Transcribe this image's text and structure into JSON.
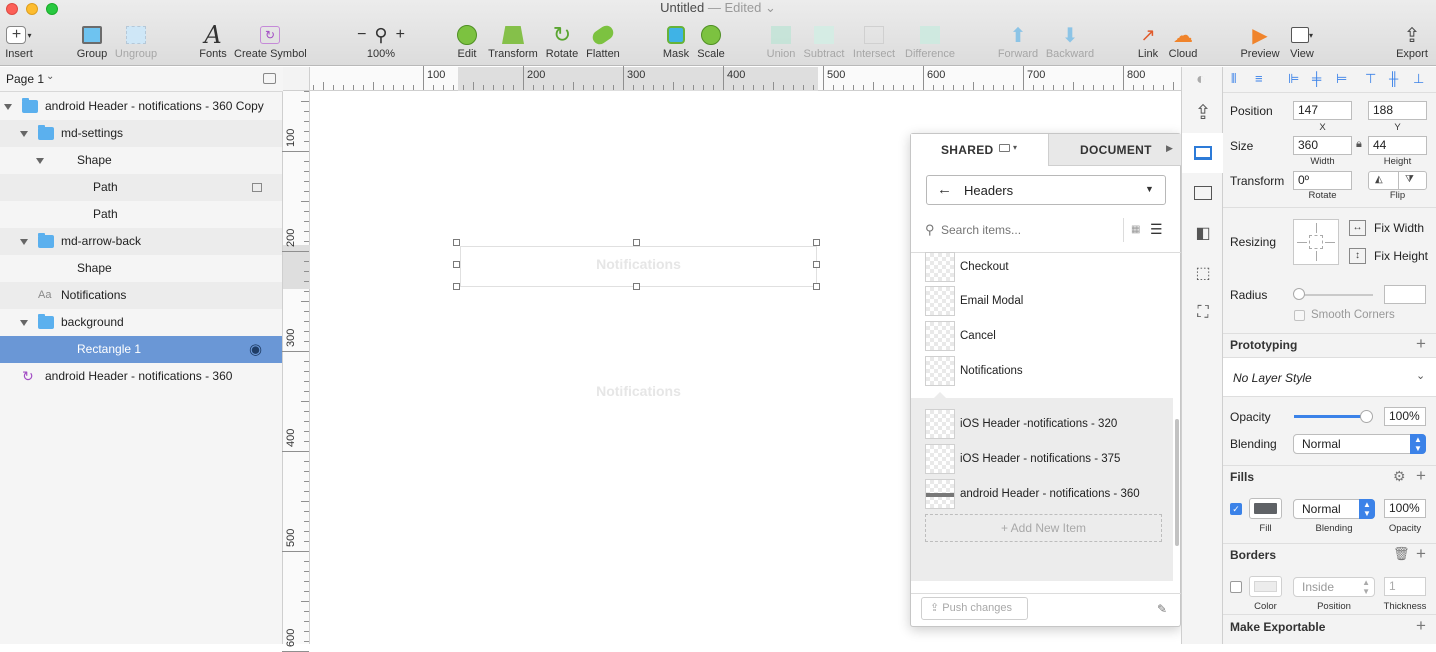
{
  "window": {
    "title": "Untitled",
    "edited": "— Edited"
  },
  "toolbar": {
    "insert": "Insert",
    "group": "Group",
    "ungroup": "Ungroup",
    "fonts": "Fonts",
    "create_symbol": "Create Symbol",
    "zoom_value": "100%",
    "edit": "Edit",
    "transform": "Transform",
    "rotate": "Rotate",
    "flatten": "Flatten",
    "mask": "Mask",
    "scale": "Scale",
    "union": "Union",
    "subtract": "Subtract",
    "intersect": "Intersect",
    "difference": "Difference",
    "forward": "Forward",
    "backward": "Backward",
    "link": "Link",
    "cloud": "Cloud",
    "preview": "Preview",
    "view": "View",
    "export": "Export"
  },
  "layers": {
    "page": "Page 1",
    "items": [
      {
        "label": "android Header - notifications - 360 Copy"
      },
      {
        "label": "md-settings"
      },
      {
        "label": "Shape"
      },
      {
        "label": "Path"
      },
      {
        "label": "Path"
      },
      {
        "label": "md-arrow-back"
      },
      {
        "label": "Shape"
      },
      {
        "label": "Notifications",
        "prefix": "Aa"
      },
      {
        "label": "background"
      },
      {
        "label": "Rectangle 1"
      },
      {
        "label": "android Header - notifications - 360"
      }
    ]
  },
  "rulers": {
    "h": [
      "100",
      "200",
      "300",
      "400",
      "500",
      "600",
      "700",
      "800"
    ],
    "v": [
      "100",
      "200",
      "300",
      "400",
      "500",
      "600"
    ]
  },
  "canvas": {
    "text1": "Notifications",
    "text2": "Notifications"
  },
  "library": {
    "tab_shared": "SHARED",
    "tab_document": "DOCUMENT",
    "category": "Headers",
    "search_placeholder": "Search items...",
    "items_top": [
      "Checkout",
      "Email Modal",
      "Cancel",
      "Notifications"
    ],
    "items_bottom": [
      "iOS Header -notifications - 320",
      "iOS Header - notifications - 375",
      "android Header - notifications - 360"
    ],
    "add_new": "+ Add New Item",
    "push": "Push changes"
  },
  "inspector": {
    "position_label": "Position",
    "pos_x": "147",
    "pos_y": "188",
    "x_label": "X",
    "y_label": "Y",
    "size_label": "Size",
    "width": "360",
    "height": "44",
    "width_label": "Width",
    "height_label": "Height",
    "transform_label": "Transform",
    "rotate_value": "0º",
    "rotate_label": "Rotate",
    "flip_label": "Flip",
    "resizing_label": "Resizing",
    "fix_width": "Fix Width",
    "fix_height": "Fix Height",
    "radius_label": "Radius",
    "smooth_corners": "Smooth Corners",
    "prototyping": "Prototyping",
    "layer_style": "No Layer Style",
    "opacity_label": "Opacity",
    "opacity_value": "100%",
    "opacity_fraction": 1.0,
    "blending_label": "Blending",
    "blending_value": "Normal",
    "fills": "Fills",
    "fill_blend": "Normal",
    "fill_opacity": "100%",
    "fill_sub": "Fill",
    "blending_sub": "Blending",
    "opacity_sub": "Opacity",
    "fill_color": "#5f6266",
    "borders": "Borders",
    "border_position": "Inside",
    "border_thickness": "1",
    "color_sub": "Color",
    "position_sub": "Position",
    "thickness_sub": "Thickness",
    "make_exportable": "Make Exportable"
  }
}
